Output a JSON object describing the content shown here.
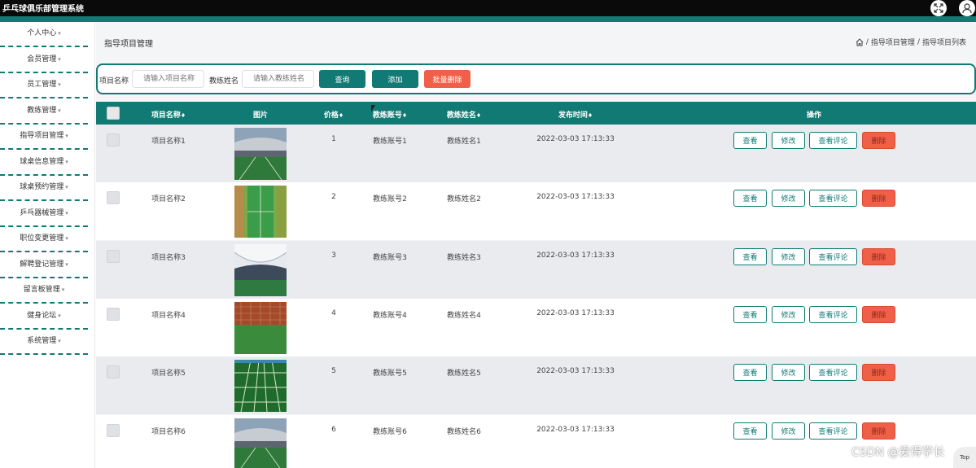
{
  "app": {
    "title": "乒乓球俱乐部管理系统"
  },
  "sidebar": {
    "items": [
      {
        "label": "个人中心"
      },
      {
        "label": "会员管理"
      },
      {
        "label": "员工管理"
      },
      {
        "label": "教练管理"
      },
      {
        "label": "指导项目管理"
      },
      {
        "label": "球桌信息管理"
      },
      {
        "label": "球桌预约管理"
      },
      {
        "label": "乒乓器械管理"
      },
      {
        "label": "职位变更管理"
      },
      {
        "label": "解聘登记管理"
      },
      {
        "label": "留言板管理"
      },
      {
        "label": "健身论坛"
      },
      {
        "label": "系统管理"
      }
    ]
  },
  "page": {
    "title": "指导项目管理"
  },
  "breadcrumb": {
    "sep": "/",
    "level1": "指导项目管理",
    "level2": "指导项目列表"
  },
  "search": {
    "name_label": "项目名称",
    "name_placeholder": "请输入项目名称",
    "coach_label": "教练姓名",
    "coach_placeholder": "请输入教练姓名",
    "query_label": "查询",
    "add_label": "添加",
    "batch_delete_label": "批量删除"
  },
  "table": {
    "headers": {
      "name": "项目名称",
      "image": "图片",
      "price": "价格",
      "account": "教练账号",
      "coach": "教练姓名",
      "time": "发布时间",
      "actions": "操作"
    },
    "sort_mark": "♦",
    "rows": [
      {
        "name": "项目名称1",
        "price": "1",
        "account": "教练账号1",
        "coach": "教练姓名1",
        "time": "2022-03-03 17:13:33",
        "img": "stadium"
      },
      {
        "name": "项目名称2",
        "price": "2",
        "account": "教练账号2",
        "coach": "教练姓名2",
        "time": "2022-03-03 17:13:33",
        "img": "field-aerial"
      },
      {
        "name": "项目名称3",
        "price": "3",
        "account": "教练账号3",
        "coach": "教练姓名3",
        "time": "2022-03-03 17:13:33",
        "img": "dome"
      },
      {
        "name": "项目名称4",
        "price": "4",
        "account": "教练账号4",
        "coach": "教练姓名4",
        "time": "2022-03-03 17:13:33",
        "img": "court"
      },
      {
        "name": "项目名称5",
        "price": "5",
        "account": "教练账号5",
        "coach": "教练姓名5",
        "time": "2022-03-03 17:13:33",
        "img": "field-grid"
      },
      {
        "name": "项目名称6",
        "price": "6",
        "account": "教练账号6",
        "coach": "教练姓名6",
        "time": "2022-03-03 17:13:33",
        "img": "stadium"
      }
    ],
    "action_labels": {
      "view": "查看",
      "edit": "修改",
      "comment": "查看评论",
      "delete": "删除"
    }
  },
  "watermark": "CSDN @爱得学长",
  "to_top": "Top",
  "colors": {
    "accent": "#117a74",
    "danger": "#f06048",
    "header_bar": "#0a0a0a"
  }
}
